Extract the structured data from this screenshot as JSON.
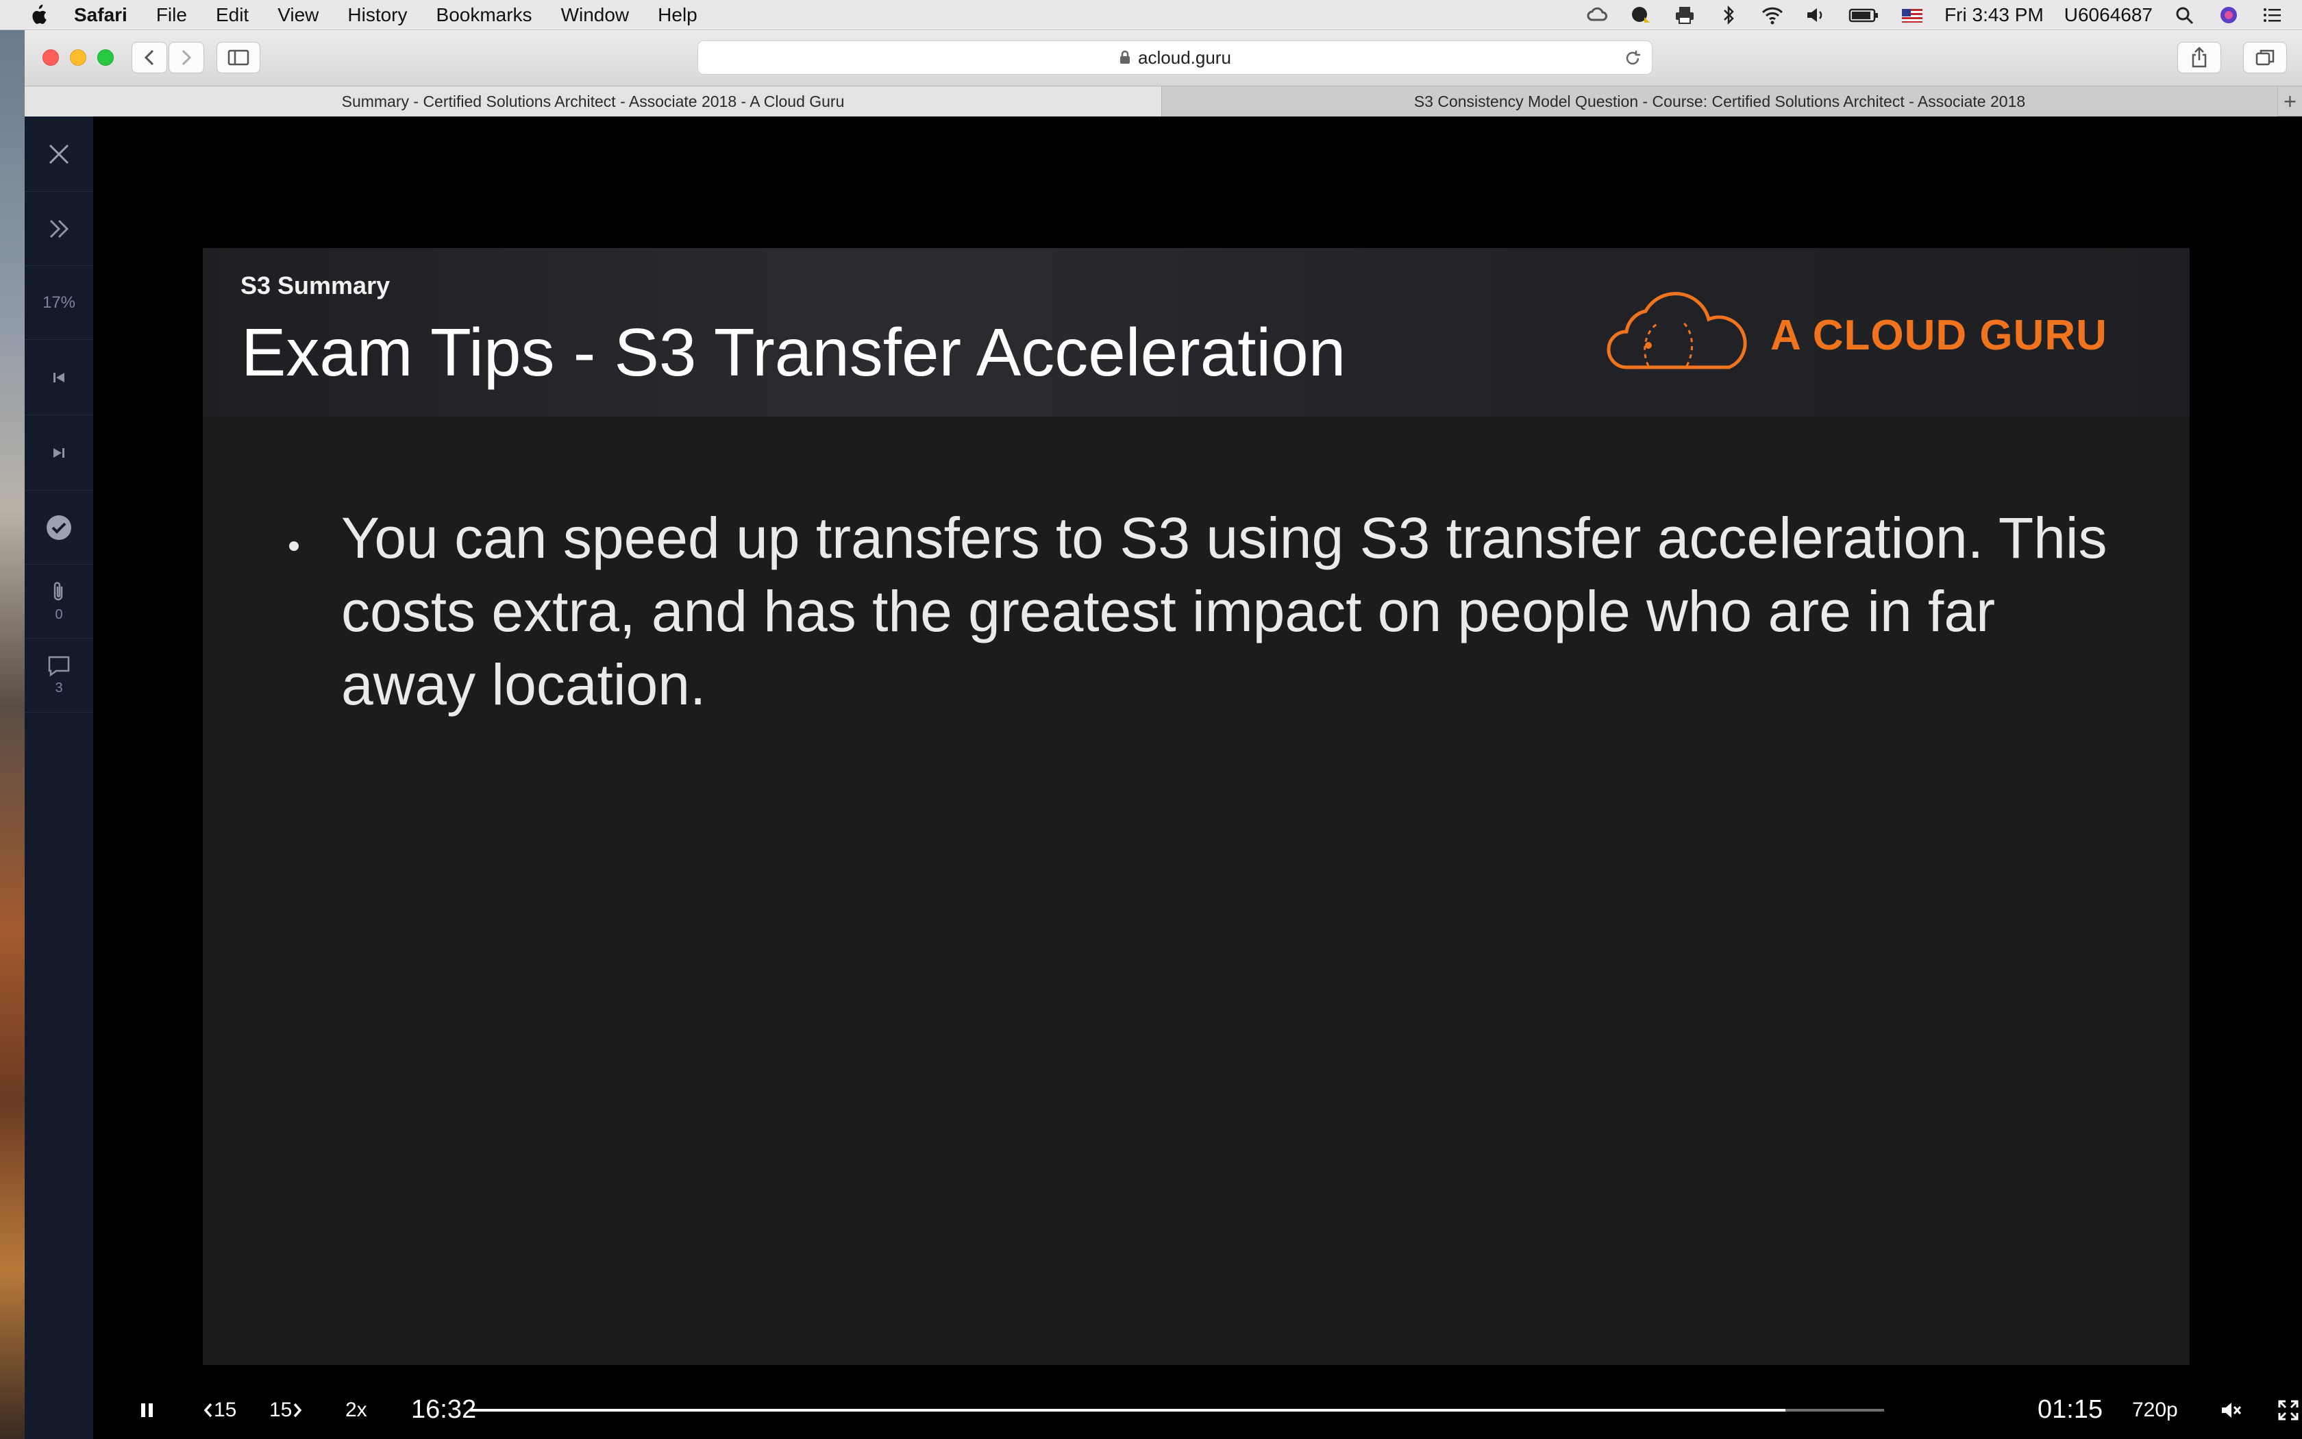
{
  "menubar": {
    "app": "Safari",
    "items": [
      "File",
      "Edit",
      "View",
      "History",
      "Bookmarks",
      "Window",
      "Help"
    ],
    "clock": "Fri 3:43 PM",
    "user": "U6064687"
  },
  "browser": {
    "address": "acloud.guru",
    "tabs": [
      {
        "title": "Summary - Certified Solutions Architect - Associate 2018 - A Cloud Guru",
        "active": true
      },
      {
        "title": "S3 Consistency Model Question - Course: Certified Solutions Architect - Associate 2018",
        "active": false
      }
    ]
  },
  "sidebar": {
    "progress": "17%",
    "attachments_count": "0",
    "comments_count": "3"
  },
  "slide": {
    "subtitle": "S3 Summary",
    "title": "Exam Tips - S3 Transfer Acceleration",
    "logo_text": "A CLOUD GURU",
    "bullet": "You can speed up transfers to S3 using S3 transfer acceleration. This costs extra, and has the greatest impact on people who are in far away location."
  },
  "player": {
    "rewind_label": "15",
    "forward_label": "15",
    "speed": "2x",
    "elapsed": "16:32",
    "remaining": "01:15",
    "quality": "720p",
    "progress_fraction": 0.93
  },
  "colors": {
    "accent_orange": "#f0731e",
    "sidebar_bg": "#131a2c",
    "slide_bg": "#1c1c1c"
  }
}
